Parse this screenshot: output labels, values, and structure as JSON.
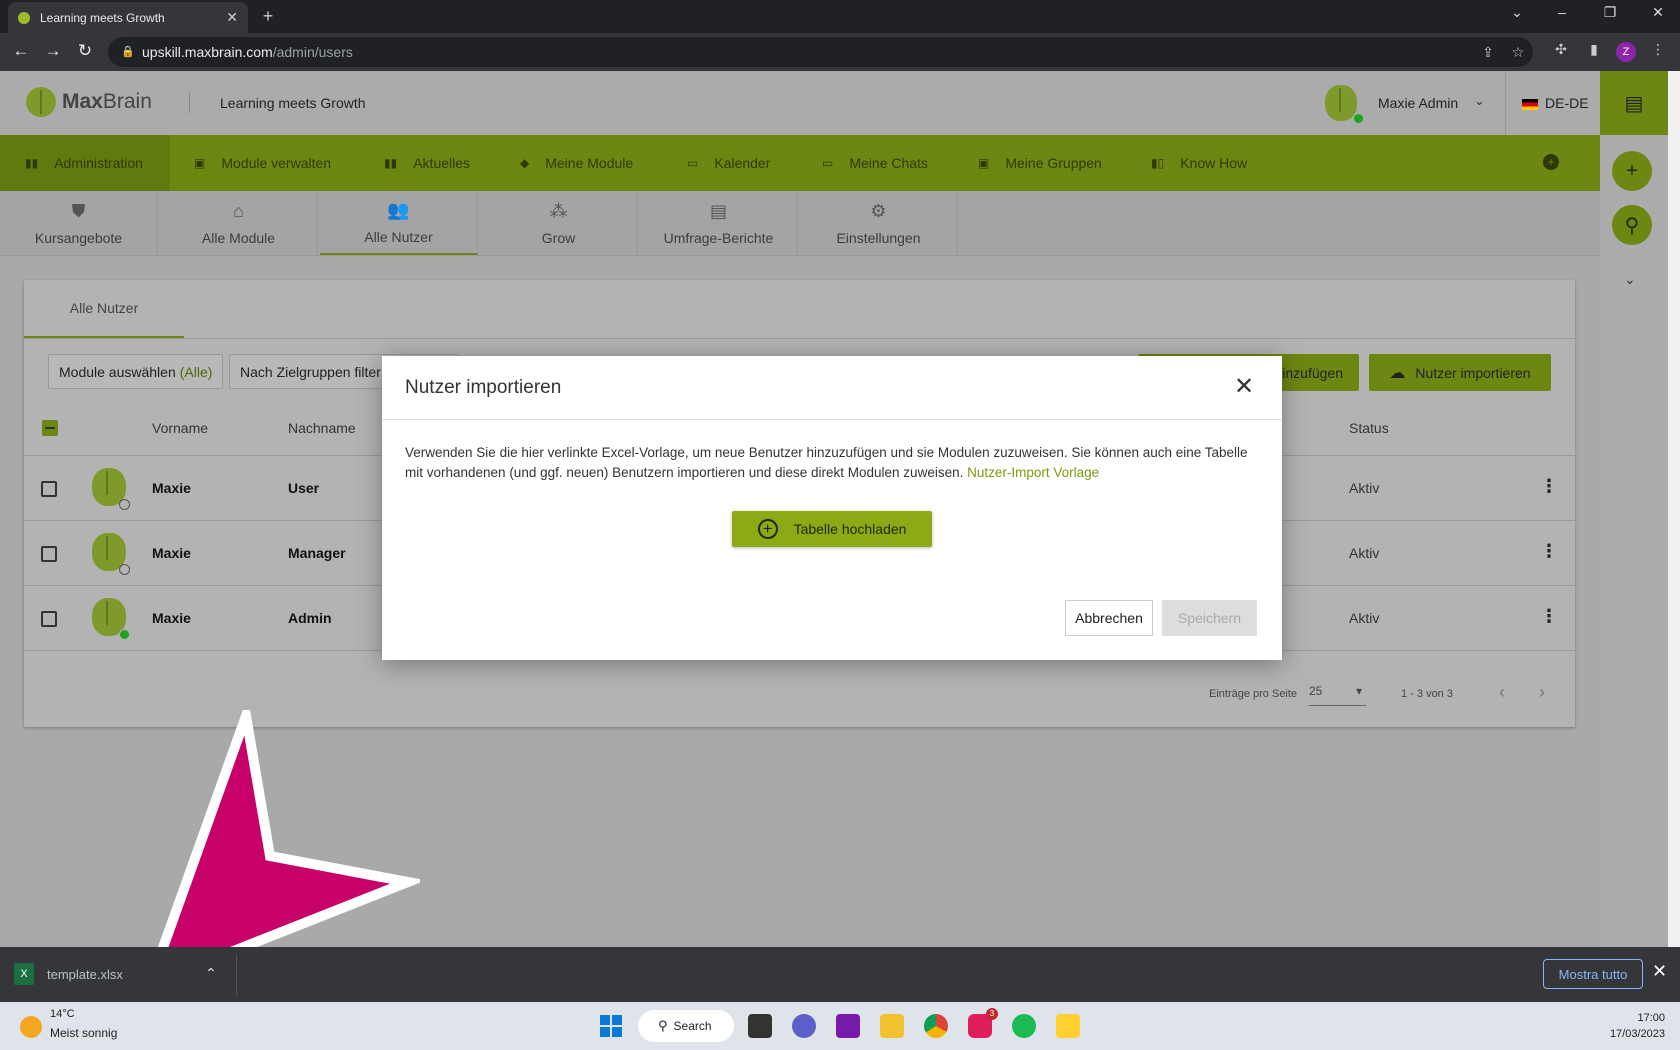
{
  "browser": {
    "tab_title": "Learning meets Growth",
    "url_host": "upskill.maxbrain.com",
    "url_path": "/admin/users",
    "profile_initial": "Z"
  },
  "header": {
    "logo_max": "Max",
    "logo_brain": "Brain",
    "tagline": "Learning meets Growth",
    "user_name": "Maxie Admin",
    "language": "DE-DE"
  },
  "main_nav": [
    "Administration",
    "Module verwalten",
    "Aktuelles",
    "Meine Module",
    "Kalender",
    "Meine Chats",
    "Meine Gruppen",
    "Know How"
  ],
  "sub_tabs": [
    "Kursangebote",
    "Alle Module",
    "Alle Nutzer",
    "Grow",
    "Umfrage-Berichte",
    "Einstellungen"
  ],
  "panel": {
    "tab": "Alle Nutzer",
    "filter_modules": "Module auswählen",
    "filter_modules_value": "(Alle)",
    "filter_groups": "Nach Zielgruppen filter",
    "add_user_partial": "inzufügen",
    "import_button": "Nutzer importieren",
    "columns": {
      "first": "Vorname",
      "last": "Nachname",
      "status": "Status"
    },
    "rows": [
      {
        "first": "Maxie",
        "last": "User",
        "status": "Aktiv"
      },
      {
        "first": "Maxie",
        "last": "Manager",
        "status": "Aktiv"
      },
      {
        "first": "Maxie",
        "last": "Admin",
        "status": "Aktiv"
      }
    ],
    "per_page_label": "Einträge pro Seite",
    "per_page_value": "25",
    "range": "1 - 3 von 3"
  },
  "modal": {
    "title": "Nutzer importieren",
    "text": "Verwenden Sie die hier verlinkte Excel-Vorlage, um neue Benutzer hinzuzufügen und sie Modulen zuzuweisen. Sie können auch eine Tabelle mit vorhandenen (und ggf. neuen) Benutzern importieren und diese direkt Modulen zuweisen.",
    "link": "Nutzer-Import Vorlage",
    "upload_button": "Tabelle hochladen",
    "cancel": "Abbrechen",
    "save": "Speichern"
  },
  "download_bar": {
    "file": "template.xlsx",
    "show_all": "Mostra tutto"
  },
  "taskbar": {
    "temp": "14°C",
    "weather": "Meist sonnig",
    "search": "Search",
    "time": "17:00",
    "date": "17/03/2023",
    "slack_badge": "3"
  },
  "colors": {
    "accent": "#8caa15",
    "arrow": "#c8006a"
  }
}
